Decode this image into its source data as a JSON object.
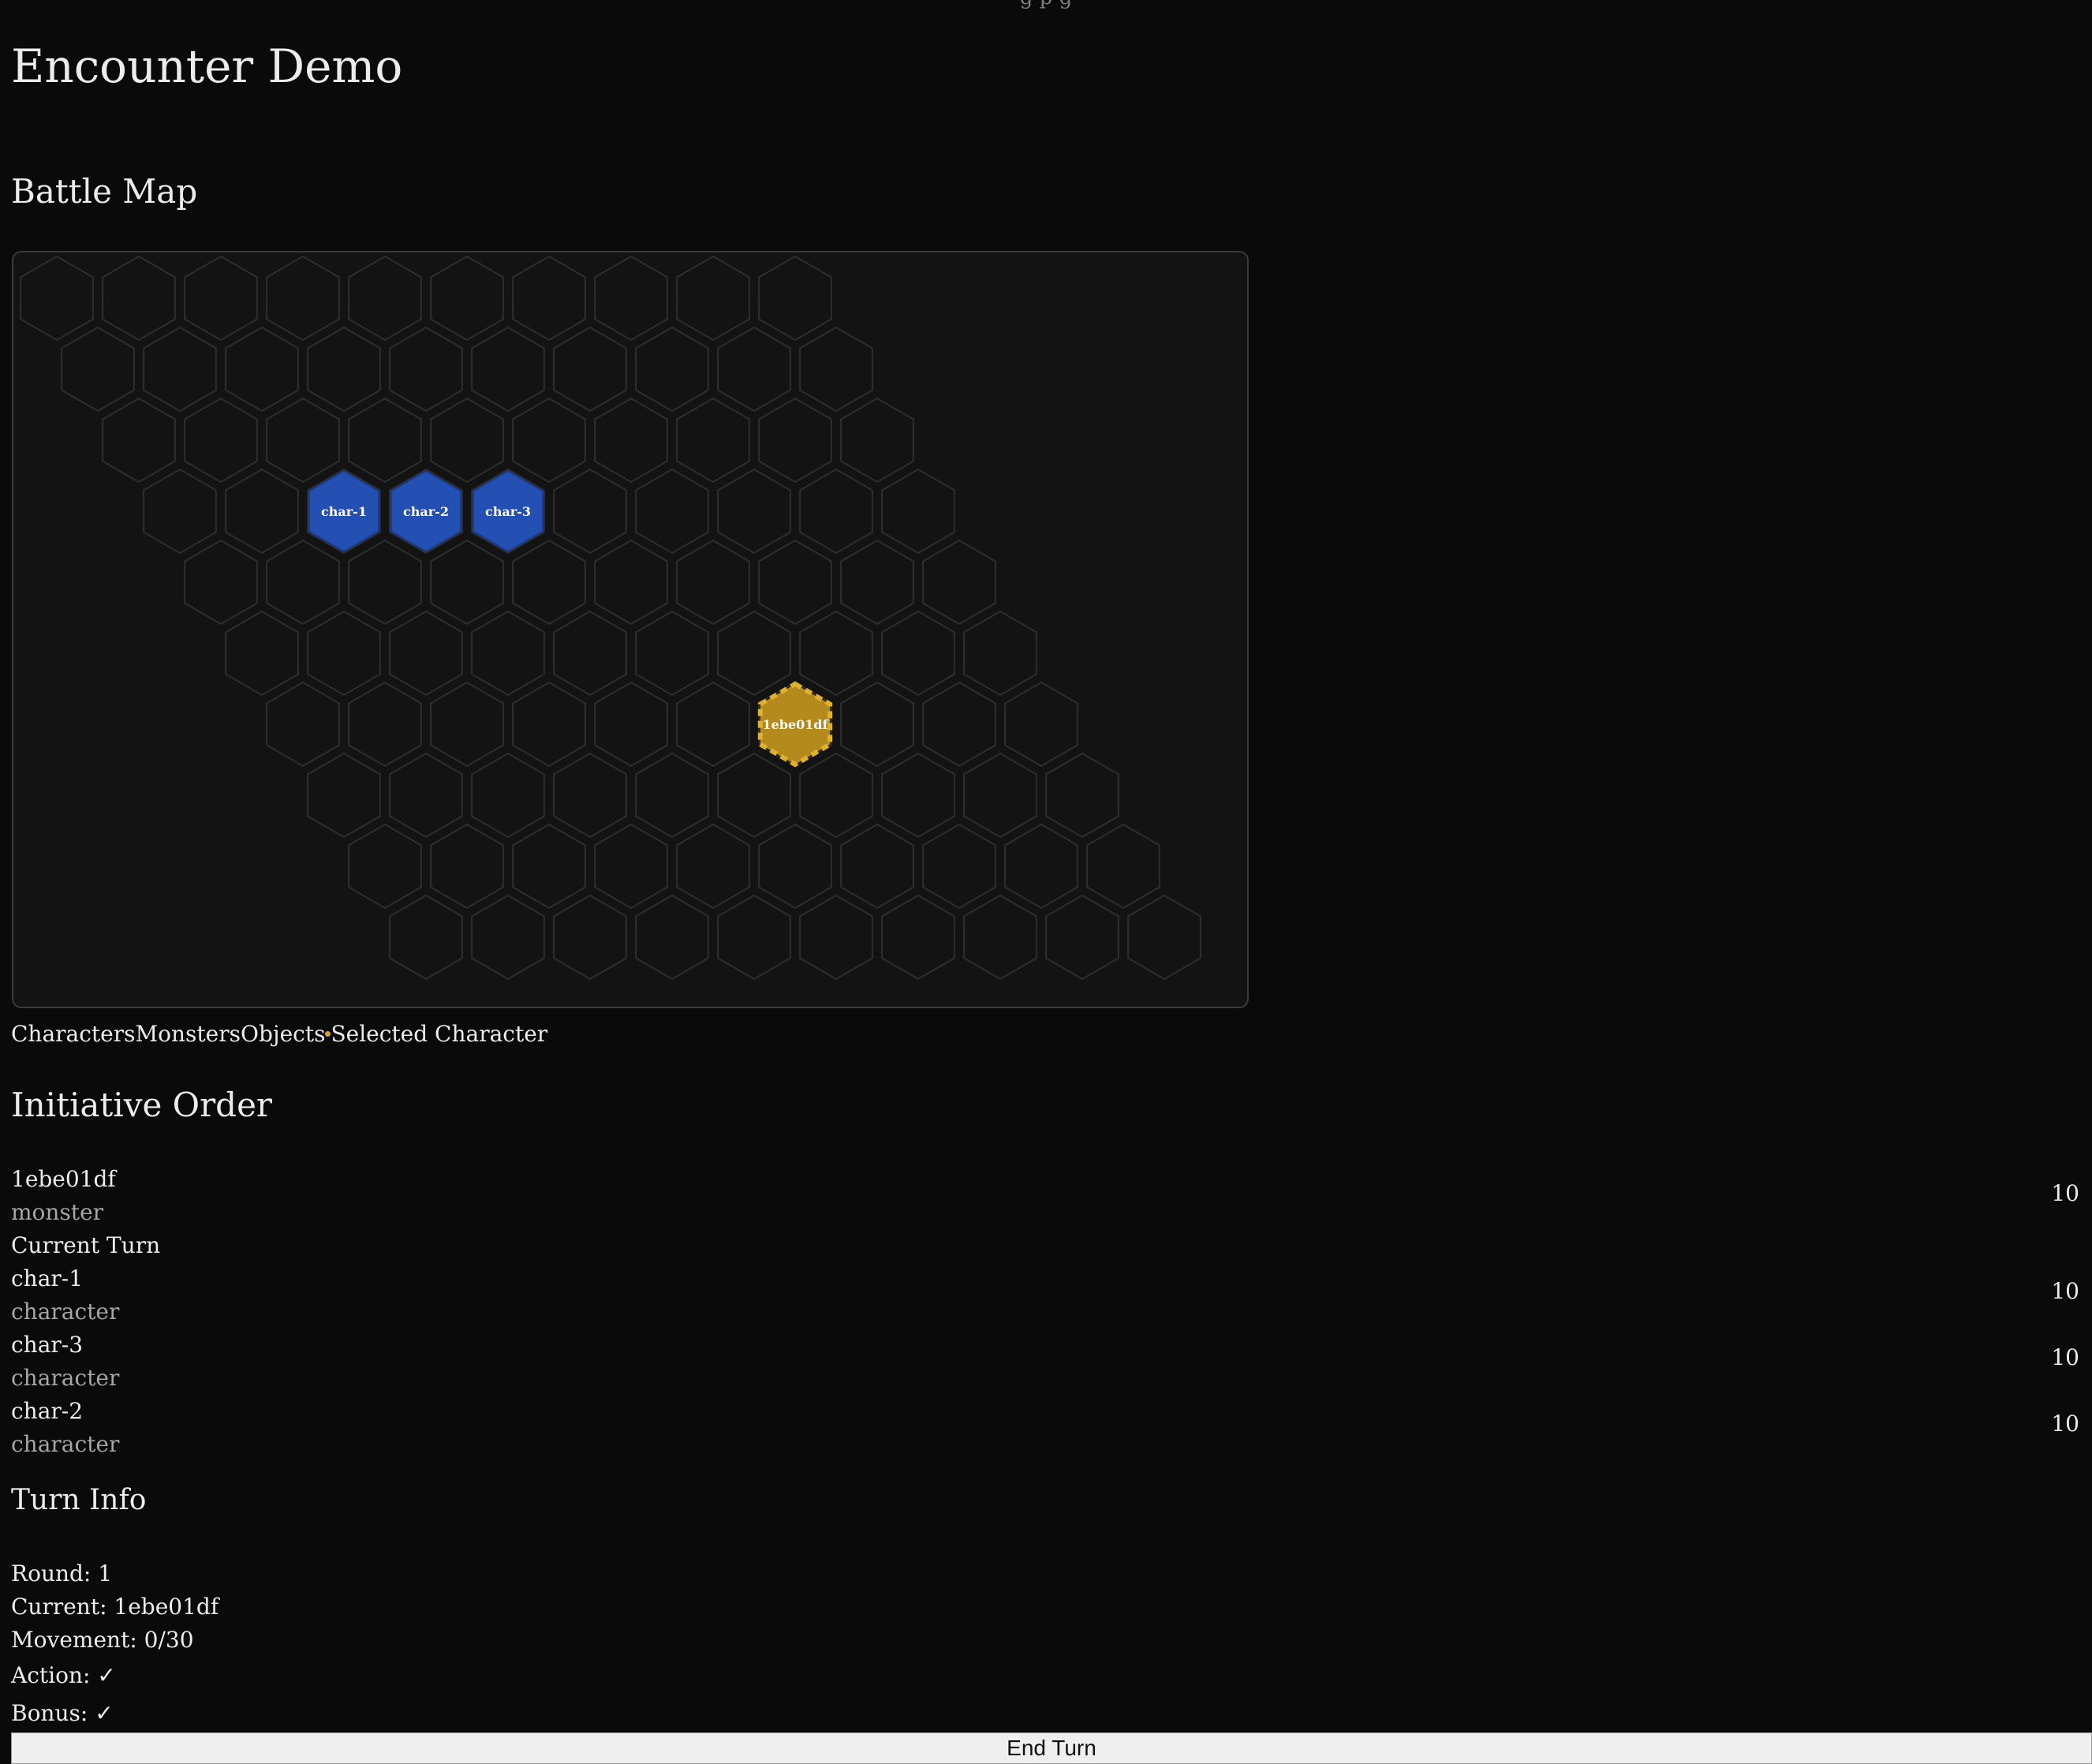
{
  "top_cut_text": "· g p  g  ·",
  "title": "Encounter Demo",
  "battle_map": {
    "heading": "Battle Map",
    "grid": {
      "rows": 10,
      "cols": 10
    },
    "tokens": [
      {
        "label": "char-1",
        "kind": "character",
        "row": 3,
        "col": 2
      },
      {
        "label": "char-2",
        "kind": "character",
        "row": 3,
        "col": 3
      },
      {
        "label": "char-3",
        "kind": "character",
        "row": 3,
        "col": 4
      },
      {
        "label": "1ebe01df",
        "kind": "monster",
        "row": 6,
        "col": 6,
        "selected": true
      }
    ],
    "colors": {
      "character": "#2450b4",
      "monster": "#b48a1c",
      "selected_outline": "#e0b030",
      "hex_stroke": "#2e2e2e"
    }
  },
  "legend": {
    "characters": "Characters",
    "monsters": "Monsters",
    "objects": "Objects",
    "selected": "Selected Character"
  },
  "initiative": {
    "heading": "Initiative Order",
    "entries": [
      {
        "name": "1ebe01df",
        "type": "monster",
        "score": "10",
        "current": "Current Turn"
      },
      {
        "name": "char-1",
        "type": "character",
        "score": "10"
      },
      {
        "name": "char-3",
        "type": "character",
        "score": "10"
      },
      {
        "name": "char-2",
        "type": "character",
        "score": "10"
      }
    ]
  },
  "turn_info": {
    "heading": "Turn Info",
    "round": "Round: 1",
    "current": "Current: 1ebe01df",
    "movement": "Movement: 0/30",
    "action": "Action: ✓",
    "bonus": "Bonus: ✓"
  },
  "end_turn_label": "End Turn"
}
